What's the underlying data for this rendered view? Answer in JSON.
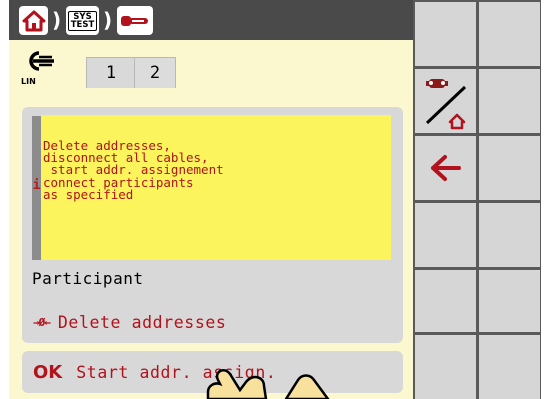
{
  "header": {
    "sys_line1": "SYS",
    "sys_line2": "TEST",
    "separator": ")",
    "home_icon": "home-icon",
    "key_icon": "key-icon"
  },
  "main": {
    "lin_label": "LIN",
    "tabs": [
      {
        "label": "1",
        "active": true
      },
      {
        "label": "2",
        "active": false
      }
    ],
    "info_marker": "i",
    "message": "Delete addresses,\ndisconnect all cables,\n start addr. assignement\nconnect participants\nas specified",
    "participant_label": "Participant",
    "buttons": {
      "delete": {
        "icon_text": "→Ø←",
        "label": "Delete addresses"
      },
      "start": {
        "icon_text": "OK",
        "label": "Start addr. assign."
      }
    }
  },
  "sidebar": {
    "rows": 6,
    "row1_icon": "tractor-to-home-icon",
    "row2_icon": "back-arrow-icon"
  },
  "colors": {
    "frame": "#5a5a5a",
    "header": "#4a4a4a",
    "content_bg": "#fbf8cf",
    "message_bg": "#fbf45d",
    "accent_red": "#b1121b",
    "button_bg": "#d8d8d8"
  }
}
